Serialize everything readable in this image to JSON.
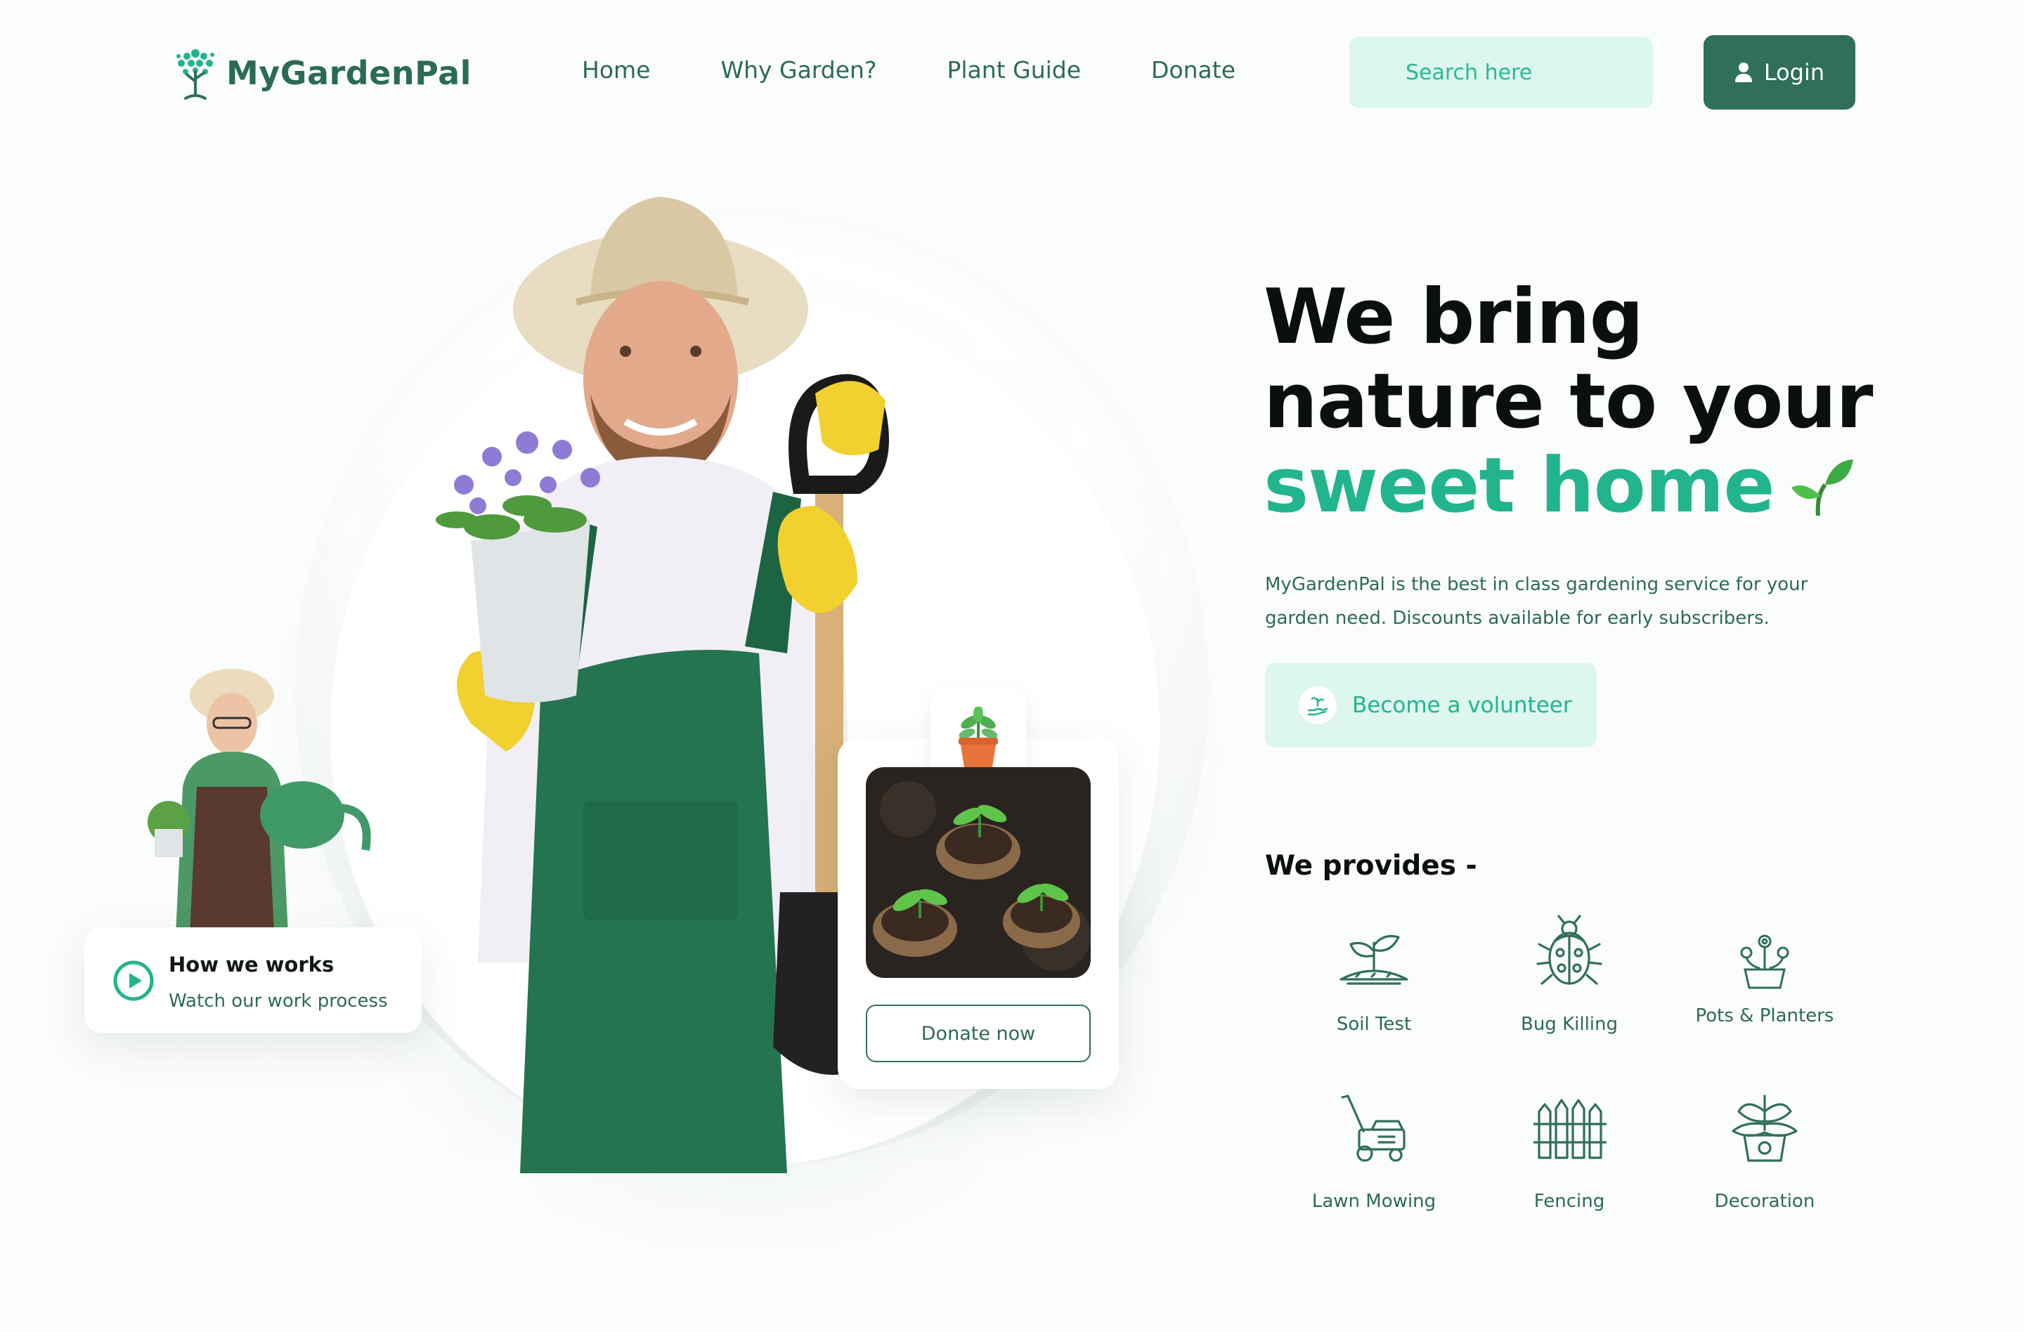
{
  "brand": {
    "name": "MyGardenPal"
  },
  "nav": {
    "items": [
      "Home",
      "Why Garden?",
      "Plant Guide",
      "Donate"
    ]
  },
  "search": {
    "placeholder": "Search here"
  },
  "login": {
    "label": "Login"
  },
  "hero": {
    "headline_line1": "We bring",
    "headline_line2": "nature to your",
    "headline_accent": "sweet home",
    "description": "MyGardenPal is the best in class gardening service for your garden need. Discounts available for early subscribers.",
    "volunteer_label": "Become a volunteer"
  },
  "video_card": {
    "title": "How we works",
    "subtitle": "Watch our work process"
  },
  "donate_card": {
    "button_label": "Donate now"
  },
  "provides": {
    "title": "We provides -",
    "services": [
      {
        "label": "Soil Test",
        "icon": "soil-test-icon"
      },
      {
        "label": "Bug Killing",
        "icon": "bug-icon"
      },
      {
        "label": "Pots & Planters",
        "icon": "flower-pot-icon"
      },
      {
        "label": "Lawn Mowing",
        "icon": "lawn-mower-icon"
      },
      {
        "label": "Fencing",
        "icon": "fence-icon"
      },
      {
        "label": "Decoration",
        "icon": "decoration-plant-icon"
      }
    ]
  },
  "colors": {
    "primary": "#2f6f5c",
    "accent": "#22b58d",
    "soft": "#ddf6ee",
    "headline": "#0b0f0d"
  }
}
